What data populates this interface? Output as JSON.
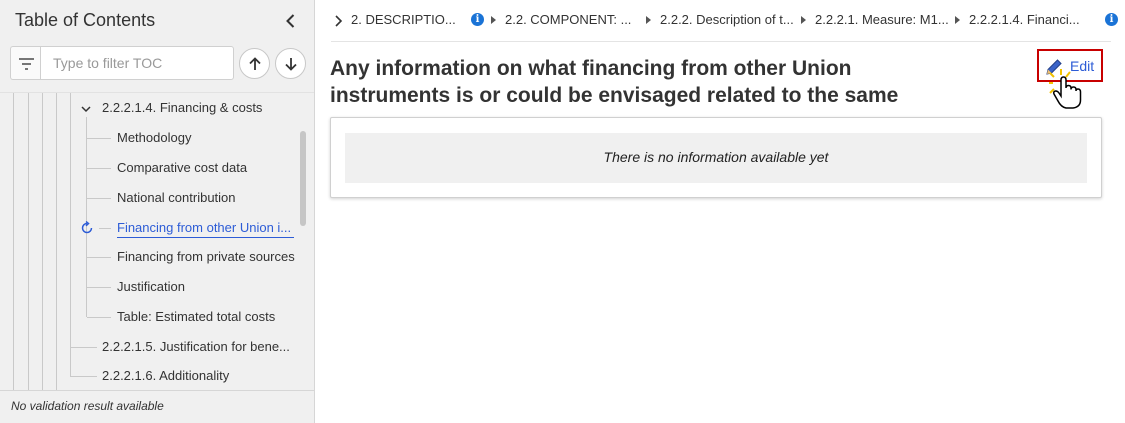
{
  "sidebar": {
    "title": "Table of Contents",
    "filter_placeholder": "Type to filter TOC",
    "tree": [
      {
        "label": "2.2.2.1.4. Financing & costs",
        "expanded": true
      },
      {
        "label": "Methodology"
      },
      {
        "label": "Comparative cost data"
      },
      {
        "label": "National contribution"
      },
      {
        "label": "Financing from other Union i...",
        "active": true
      },
      {
        "label": "Financing from private sources"
      },
      {
        "label": "Justification"
      },
      {
        "label": "Table: Estimated total costs"
      },
      {
        "label": "2.2.2.1.5. Justification for bene..."
      },
      {
        "label": "2.2.2.1.6. Additionality"
      }
    ],
    "footer": "No validation result available"
  },
  "breadcrumb": [
    "2. DESCRIPTIO...",
    "2.2. COMPONENT: ...",
    "2.2.2. Description of t...",
    "2.2.2.1. Measure: M1...",
    "2.2.2.1.4. Financi..."
  ],
  "main": {
    "title": "Any information on what financing from other Union instruments is or could be envisaged related to the same measure",
    "edit_label": "Edit",
    "empty_message": "There is no information available yet"
  },
  "colors": {
    "accent_link": "#2d5cd6",
    "info_icon": "#1a73d6",
    "edit_highlight": "#c80000",
    "sidebar_bg": "#f0f0f0"
  },
  "icons": [
    "chevron-left-icon",
    "filter-icon",
    "arrow-up-icon",
    "arrow-down-icon",
    "chevron-down-icon",
    "refresh-icon",
    "chevron-right-icon",
    "info-icon",
    "pencil-icon",
    "hand-cursor-icon"
  ]
}
